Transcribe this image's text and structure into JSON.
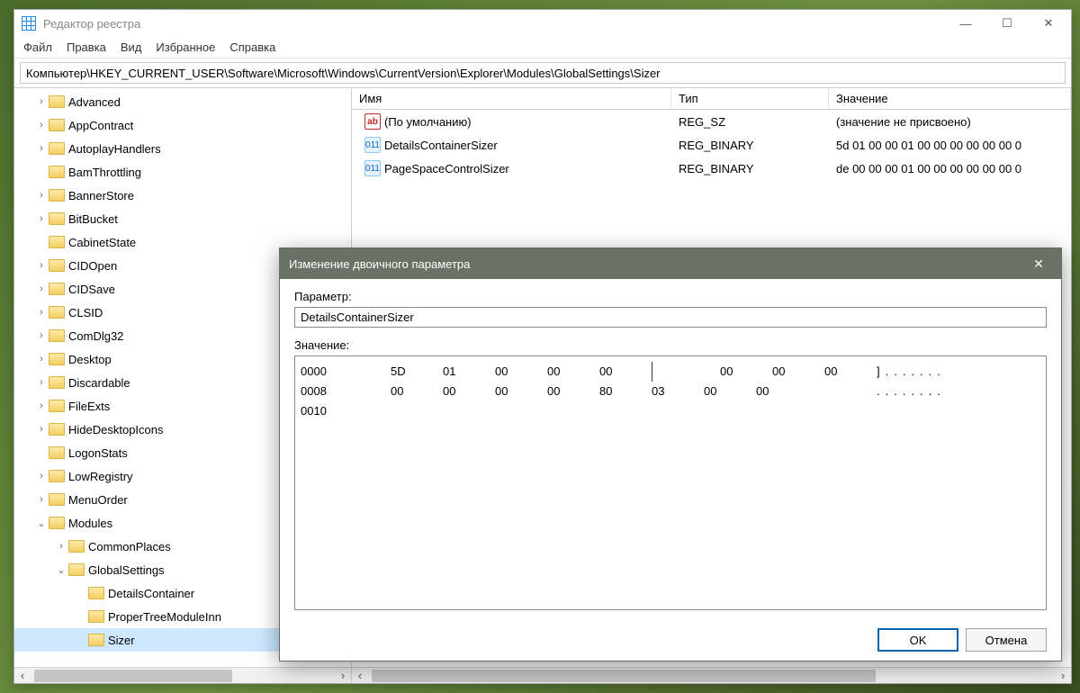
{
  "window": {
    "title": "Редактор реестра",
    "menu": [
      "Файл",
      "Правка",
      "Вид",
      "Избранное",
      "Справка"
    ],
    "path": "Компьютер\\HKEY_CURRENT_USER\\Software\\Microsoft\\Windows\\CurrentVersion\\Explorer\\Modules\\GlobalSettings\\Sizer"
  },
  "tree": [
    {
      "label": "Advanced",
      "exp": ">",
      "d": 0
    },
    {
      "label": "AppContract",
      "exp": ">",
      "d": 0
    },
    {
      "label": "AutoplayHandlers",
      "exp": ">",
      "d": 0
    },
    {
      "label": "BamThrottling",
      "exp": "",
      "d": 0
    },
    {
      "label": "BannerStore",
      "exp": ">",
      "d": 0
    },
    {
      "label": "BitBucket",
      "exp": ">",
      "d": 0
    },
    {
      "label": "CabinetState",
      "exp": "",
      "d": 0
    },
    {
      "label": "CIDOpen",
      "exp": ">",
      "d": 0
    },
    {
      "label": "CIDSave",
      "exp": ">",
      "d": 0
    },
    {
      "label": "CLSID",
      "exp": ">",
      "d": 0
    },
    {
      "label": "ComDlg32",
      "exp": ">",
      "d": 0
    },
    {
      "label": "Desktop",
      "exp": ">",
      "d": 0
    },
    {
      "label": "Discardable",
      "exp": ">",
      "d": 0
    },
    {
      "label": "FileExts",
      "exp": ">",
      "d": 0
    },
    {
      "label": "HideDesktopIcons",
      "exp": ">",
      "d": 0
    },
    {
      "label": "LogonStats",
      "exp": "",
      "d": 0
    },
    {
      "label": "LowRegistry",
      "exp": ">",
      "d": 0
    },
    {
      "label": "MenuOrder",
      "exp": ">",
      "d": 0
    },
    {
      "label": "Modules",
      "exp": "v",
      "d": 0
    },
    {
      "label": "CommonPlaces",
      "exp": ">",
      "d": 1
    },
    {
      "label": "GlobalSettings",
      "exp": "v",
      "d": 1
    },
    {
      "label": "DetailsContainer",
      "exp": "",
      "d": 2
    },
    {
      "label": "ProperTreeModuleInn",
      "exp": "",
      "d": 2
    },
    {
      "label": "Sizer",
      "exp": "",
      "d": 2,
      "sel": true
    }
  ],
  "list": {
    "headers": {
      "name": "Имя",
      "type": "Тип",
      "value": "Значение"
    },
    "rows": [
      {
        "icon": "sz",
        "name": "(По умолчанию)",
        "type": "REG_SZ",
        "value": "(значение не присвоено)"
      },
      {
        "icon": "bin",
        "name": "DetailsContainerSizer",
        "type": "REG_BINARY",
        "value": "5d 01 00 00 01 00 00 00 00 00 00 0"
      },
      {
        "icon": "bin",
        "name": "PageSpaceControlSizer",
        "type": "REG_BINARY",
        "value": "de 00 00 00 01 00 00 00 00 00 00 0"
      }
    ]
  },
  "dialog": {
    "title": "Изменение двоичного параметра",
    "param_label": "Параметр:",
    "param_value": "DetailsContainerSizer",
    "value_label": "Значение:",
    "hex": [
      {
        "off": "0000",
        "b": [
          "5D",
          "01",
          "00",
          "00",
          "00",
          "00",
          "00",
          "00"
        ],
        "a": "]......."
      },
      {
        "off": "0008",
        "b": [
          "00",
          "00",
          "00",
          "00",
          "80",
          "03",
          "00",
          "00"
        ],
        "a": "........"
      },
      {
        "off": "0010",
        "b": [
          "",
          "",
          "",
          "",
          "",
          "",
          "",
          ""
        ],
        "a": ""
      }
    ],
    "ok": "OK",
    "cancel": "Отмена"
  }
}
